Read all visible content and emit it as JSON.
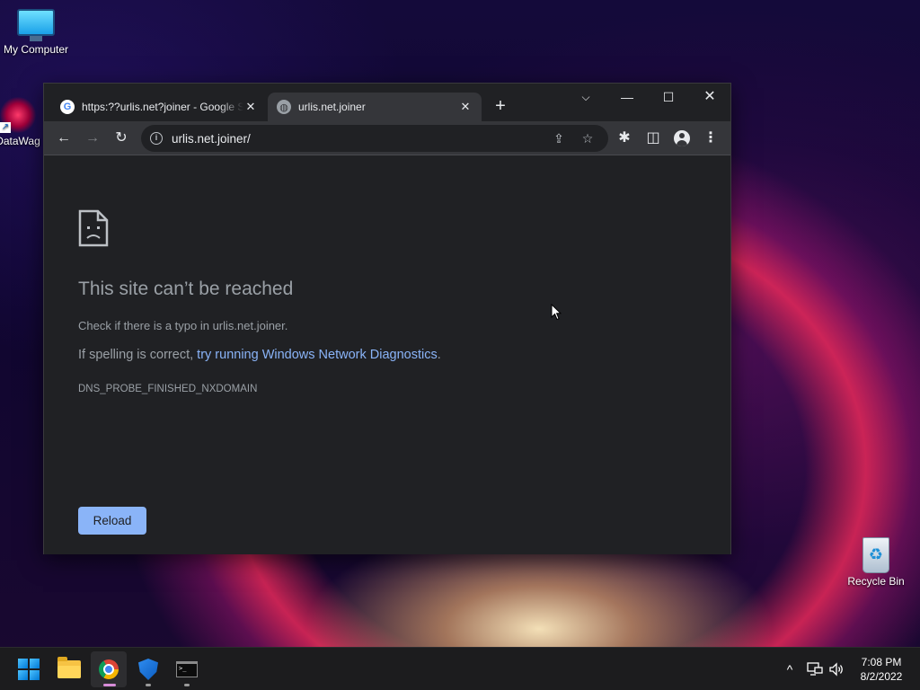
{
  "desktop": {
    "icons": [
      {
        "label": "My Computer"
      },
      {
        "label": "DataWag"
      },
      {
        "label": "Recycle Bin"
      }
    ]
  },
  "browser": {
    "tabs": [
      {
        "title": "https:??urlis.net?joiner - Google S",
        "favicon": "google-icon",
        "close": "✕"
      },
      {
        "title": "urlis.net.joiner",
        "favicon": "globe-icon",
        "close": "✕"
      }
    ],
    "new_tab": "+",
    "window_controls": {
      "dropdown": "⌵",
      "minimize": "—",
      "maximize": "☐",
      "close": "✕"
    },
    "toolbar": {
      "back": "←",
      "forward": "→",
      "reload": "↻",
      "url": "urlis.net.joiner/",
      "share": "⇪",
      "bookmark": "☆",
      "extensions": "✱",
      "side_panel": "◫",
      "menu": "⋮"
    },
    "error_page": {
      "title": "This site can’t be reached",
      "line1": "Check if there is a typo in urlis.net.joiner.",
      "line2_prefix": "If spelling is correct, ",
      "line2_link": "try running Windows Network Diagnostics",
      "line2_suffix": ".",
      "error_code": "DNS_PROBE_FINISHED_NXDOMAIN",
      "reload_button": "Reload"
    }
  },
  "taskbar": {
    "apps": [
      {
        "name": "start",
        "icon": "windows-logo-icon"
      },
      {
        "name": "file-explorer",
        "icon": "folder-icon"
      },
      {
        "name": "chrome",
        "icon": "chrome-icon",
        "active": true
      },
      {
        "name": "windows-security",
        "icon": "shield-icon"
      },
      {
        "name": "terminal",
        "icon": "terminal-icon"
      }
    ],
    "tray": {
      "chevron": "^",
      "network": "🖧",
      "volume": "🔊"
    },
    "clock": {
      "time": "7:08 PM",
      "date": "8/2/2022"
    }
  },
  "colors": {
    "link": "#8ab4f8",
    "reload_button_bg": "#8ab4f8",
    "page_bg": "#202124",
    "toolbar_bg": "#35363a"
  }
}
